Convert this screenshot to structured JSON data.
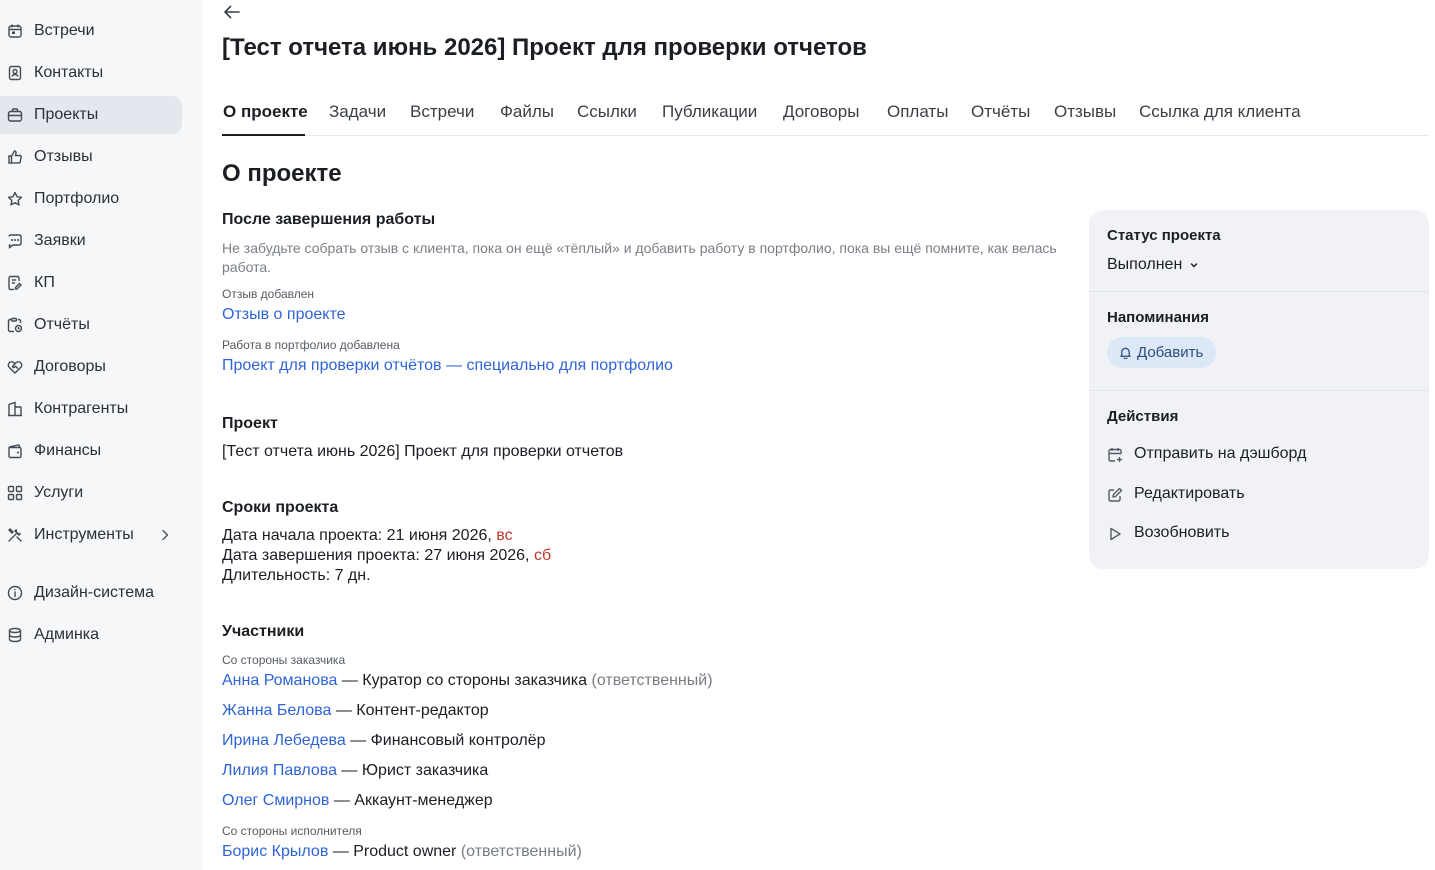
{
  "sidebar": {
    "items": [
      {
        "label": "Встречи",
        "icon": "calendar-icon"
      },
      {
        "label": "Контакты",
        "icon": "contacts-icon"
      },
      {
        "label": "Проекты",
        "icon": "briefcase-icon",
        "active": true
      },
      {
        "label": "Отзывы",
        "icon": "thumbs-up-icon"
      },
      {
        "label": "Портфолио",
        "icon": "star-icon"
      },
      {
        "label": "Заявки",
        "icon": "chat-icon"
      },
      {
        "label": "КП",
        "icon": "document-edit-icon"
      },
      {
        "label": "Отчёты",
        "icon": "report-icon"
      },
      {
        "label": "Договоры",
        "icon": "handshake-icon"
      },
      {
        "label": "Контрагенты",
        "icon": "building-icon"
      },
      {
        "label": "Финансы",
        "icon": "wallet-icon"
      },
      {
        "label": "Услуги",
        "icon": "grid-icon"
      },
      {
        "label": "Инструменты",
        "icon": "tools-icon"
      },
      {
        "label": "Дизайн-система",
        "icon": "info-icon"
      },
      {
        "label": "Админка",
        "icon": "database-icon"
      }
    ]
  },
  "page": {
    "title": "[Тест отчета июнь 2026] Проект для проверки отчетов"
  },
  "tabs": [
    "О проекте",
    "Задачи",
    "Встречи",
    "Файлы",
    "Ссылки",
    "Публикации",
    "Договоры",
    "Оплаты",
    "Отчёты",
    "Отзывы",
    "Ссылка для клиента"
  ],
  "about": {
    "heading": "О проекте",
    "after": {
      "title": "После завершения работы",
      "hint": "Не забудьте собрать отзыв с клиента, пока он ещё «тёплый» и добавить работу в портфолио, пока вы ещё помните, как велась работа.",
      "review_label": "Отзыв добавлен",
      "review_link": "Отзыв о проекте",
      "portfolio_label": "Работа в портфолио добавлена",
      "portfolio_link": "Проект для проверки отчётов — специально для портфолио"
    },
    "project": {
      "title": "Проект",
      "name": "[Тест отчета июнь 2026] Проект для проверки отчетов"
    },
    "dates": {
      "title": "Сроки проекта",
      "start_text": "Дата начала проекта: 21 июня 2026, ",
      "start_day": "вс",
      "end_text": "Дата завершения проекта: 27 июня 2026, ",
      "end_day": "сб",
      "duration": "Длительность: 7 дн."
    },
    "participants": {
      "title": "Участники",
      "client_label": "Со стороны заказчика",
      "client": [
        {
          "name": "Анна Романова",
          "role": " — Куратор со стороны заказчика ",
          "note": "(ответственный)"
        },
        {
          "name": "Жанна Белова",
          "role": " — Контент-редактор",
          "note": ""
        },
        {
          "name": "Ирина Лебедева",
          "role": " — Финансовый контролёр",
          "note": ""
        },
        {
          "name": "Лилия Павлова",
          "role": " — Юрист заказчика",
          "note": ""
        },
        {
          "name": "Олег Смирнов",
          "role": " — Аккаунт-менеджер",
          "note": ""
        }
      ],
      "exec_label": "Со стороны исполнителя",
      "exec": [
        {
          "name": "Борис Крылов",
          "role": " — Product owner ",
          "note": "(ответственный)"
        }
      ]
    }
  },
  "panel": {
    "status_title": "Статус проекта",
    "status_value": "Выполнен",
    "reminders_title": "Напоминания",
    "reminders_add": "Добавить",
    "actions_title": "Действия",
    "actions": [
      {
        "label": "Отправить на дэшборд",
        "icon": "calendar-plus-icon"
      },
      {
        "label": "Редактировать",
        "icon": "edit-icon"
      },
      {
        "label": "Возобновить",
        "icon": "play-icon"
      }
    ]
  }
}
